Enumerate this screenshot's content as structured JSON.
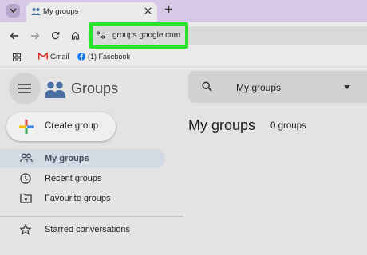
{
  "browser": {
    "tab": {
      "title": "My groups"
    },
    "address_bar": {
      "url": "groups.google.com"
    },
    "bookmarks": [
      {
        "label": "Gmail"
      },
      {
        "label": "(1) Facebook"
      }
    ]
  },
  "app": {
    "product_name": "Groups",
    "search": {
      "scope": "My groups"
    },
    "create_button": {
      "label": "Create group"
    },
    "sidebar": {
      "items": [
        {
          "label": "My groups",
          "icon": "people-icon",
          "active": true
        },
        {
          "label": "Recent groups",
          "icon": "clock-icon",
          "active": false
        },
        {
          "label": "Favourite groups",
          "icon": "star-folder-icon",
          "active": false
        },
        {
          "label": "Starred conversations",
          "icon": "star-icon",
          "active": false
        }
      ]
    },
    "main": {
      "title": "My groups",
      "count_text": "0 groups"
    }
  },
  "colors": {
    "highlight": "#2ae32a",
    "tabbar": "#d7c8e6",
    "active_nav": "#d2dae3",
    "groups_blue": "#4a6fa5"
  }
}
